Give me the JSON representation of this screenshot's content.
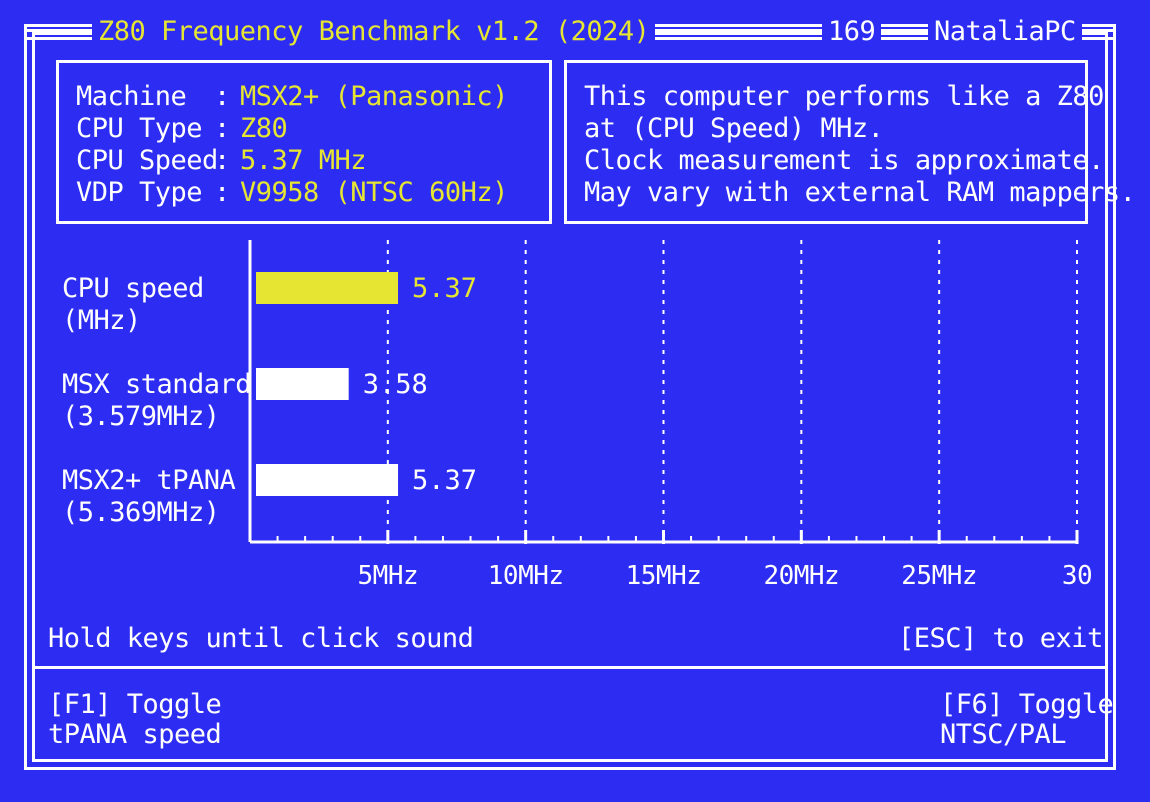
{
  "window": {
    "title": "Z80 Frequency Benchmark v1.2 (2024)",
    "counter": "169",
    "machine_name": "NataliaPC"
  },
  "info": {
    "rows": [
      {
        "label": "Machine",
        "sep": ":",
        "value": "MSX2+ (Panasonic)"
      },
      {
        "label": "CPU Type",
        "sep": ":",
        "value": "Z80"
      },
      {
        "label": "CPU Speed",
        "sep": ":",
        "value": "5.37 MHz"
      },
      {
        "label": "VDP Type",
        "sep": ":",
        "value": "V9958 (NTSC 60Hz)"
      }
    ]
  },
  "note": {
    "lines": [
      "This computer performs like a Z80",
      "at (CPU Speed) MHz.",
      "Clock measurement is approximate.",
      "May vary with external RAM mappers."
    ]
  },
  "chart_data": {
    "type": "bar",
    "orientation": "horizontal",
    "categories": [
      {
        "line1": "CPU speed",
        "line2": "(MHz)"
      },
      {
        "line1": "MSX standard",
        "line2": "(3.579MHz)"
      },
      {
        "line1": "MSX2+ tPANA",
        "line2": "(5.369MHz)"
      }
    ],
    "values": [
      5.37,
      3.58,
      5.37
    ],
    "value_labels": [
      "5.37",
      "3.58",
      "5.37"
    ],
    "bar_colors": [
      "#e6e632",
      "#ffffff",
      "#ffffff"
    ],
    "label_colors": [
      "#e6e632",
      "#ffffff",
      "#ffffff"
    ],
    "xlim": [
      0,
      30
    ],
    "x_ticks": [
      5,
      10,
      15,
      20,
      25,
      30
    ],
    "x_tick_labels": [
      "5MHz",
      "10MHz",
      "15MHz",
      "20MHz",
      "25MHz",
      "30"
    ],
    "grid": true
  },
  "footer": {
    "hint_left": "Hold keys until click sound",
    "hint_right": "[ESC] to exit",
    "f1_line1": "[F1] Toggle",
    "f1_line2": "tPANA speed",
    "f6_line1": "[F6] Toggle",
    "f6_line2": "NTSC/PAL"
  },
  "colors": {
    "background": "#2c2cf2",
    "foreground": "#ffffff",
    "highlight": "#e6e632"
  }
}
